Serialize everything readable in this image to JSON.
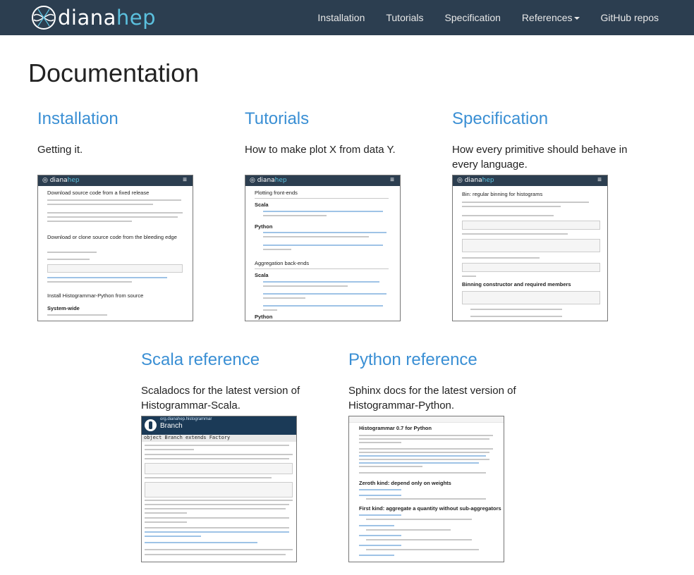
{
  "navbar": {
    "brand_a": "diana",
    "brand_b": "hep",
    "items": [
      "Installation",
      "Tutorials",
      "Specification",
      "References",
      "GitHub repos"
    ]
  },
  "page": {
    "title": "Documentation"
  },
  "cards": [
    {
      "title": "Installation",
      "desc": "Getting it."
    },
    {
      "title": "Tutorials",
      "desc": "How to make plot X from data Y."
    },
    {
      "title": "Specification",
      "desc": "How every primitive should behave in every language."
    },
    {
      "title": "Scala reference",
      "desc": "Scaladocs for the latest version of Histogrammar-Scala."
    },
    {
      "title": "Python reference",
      "desc": "Sphinx docs for the latest version of Histogrammar-Python."
    }
  ],
  "thumbs": {
    "install": {
      "h1": "Download source code from a fixed release",
      "h2": "Download or clone source code from the bleeding edge",
      "h3": "Install Histogrammar-Python from source",
      "h4": "System-wide"
    },
    "tutorials": {
      "h1": "Plotting front-ends",
      "s1": "Scala",
      "s2": "Python",
      "h2": "Aggregation back-ends",
      "s3": "Scala",
      "s4": "Python"
    },
    "spec": {
      "h1": "Bin: regular binning for histograms",
      "h2": "Binning constructor and required members"
    },
    "scala": {
      "pkg": "org.dianahep.histogrammar",
      "name": "Branch",
      "sig": "object Branch extends Factory"
    },
    "python": {
      "h1": "Histogrammar 0.7 for Python",
      "h2": "Zeroth kind: depend only on weights",
      "h3": "First kind: aggregate a quantity without sub-aggregators"
    }
  },
  "colors": {
    "navbar": "#2c3e50",
    "link": "#3a8fd4",
    "brand_accent": "#5bc0de"
  }
}
